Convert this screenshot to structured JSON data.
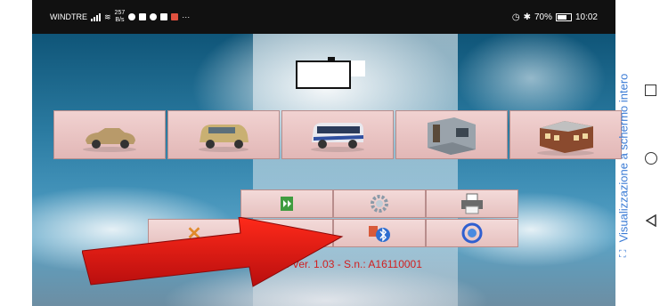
{
  "status_bar": {
    "carrier": "WINDTRE",
    "speed_value": "257",
    "speed_unit": "B/s",
    "overflow": "···",
    "battery": "70%",
    "time": "10:02"
  },
  "app": {
    "version_text": "r. Ver. 1.03 - S.n.: A16110001",
    "menu_items": [
      {
        "name": "car",
        "icon": "car-convertible-icon"
      },
      {
        "name": "van",
        "icon": "minivan-icon"
      },
      {
        "name": "bus",
        "icon": "bus-icon"
      },
      {
        "name": "room",
        "icon": "room-interior-icon"
      },
      {
        "name": "building",
        "icon": "building-icon"
      }
    ],
    "toolbar_icons": [
      "book-icon",
      "gear-icon",
      "printer-icon",
      "close-icon",
      "bluetooth-icon",
      "sync-icon"
    ]
  },
  "system": {
    "side_label": "Visualizzazione a schermo intero"
  },
  "colors": {
    "accent_red": "#d21f1f",
    "button_pink": "#f1d2d1",
    "side_text_blue": "#3a7bd5"
  }
}
